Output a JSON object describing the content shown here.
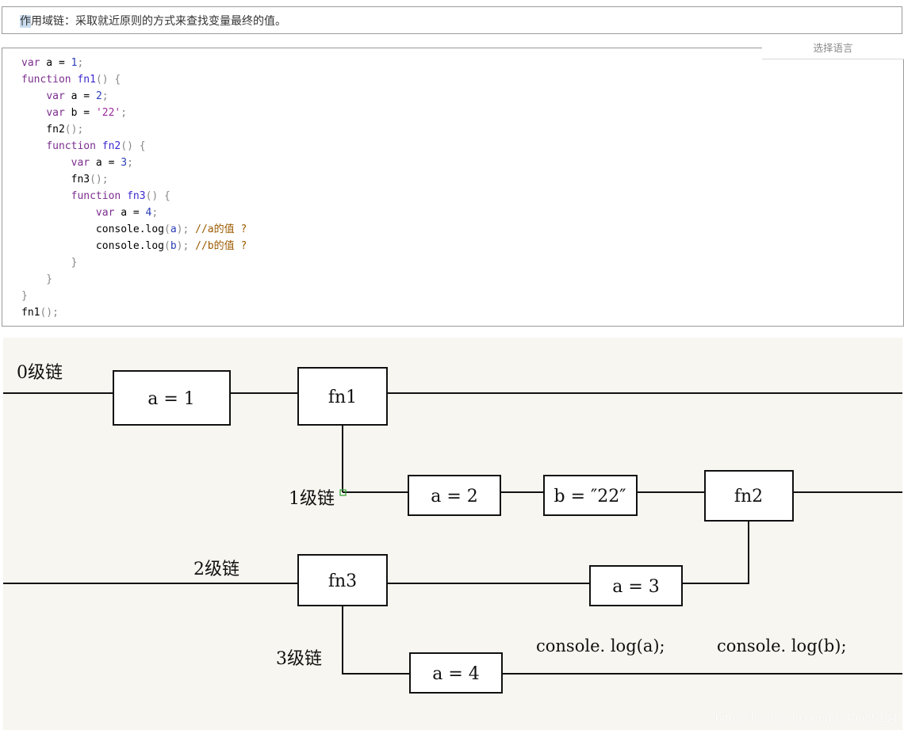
{
  "intro": {
    "highlight": "作",
    "rest": "用域链：采取就近原则的方式来查找变量最终的值。"
  },
  "code_block": {
    "language_selector": "选择语言",
    "lines": [
      [
        {
          "t": "var",
          "c": "k"
        },
        {
          "t": " a = ",
          "c": "x"
        },
        {
          "t": "1",
          "c": "n"
        },
        {
          "t": ";",
          "c": "p"
        }
      ],
      [
        {
          "t": "function",
          "c": "k"
        },
        {
          "t": " ",
          "c": "x"
        },
        {
          "t": "fn1",
          "c": "fn"
        },
        {
          "t": "() {",
          "c": "p"
        }
      ],
      [
        {
          "t": "    ",
          "c": "x"
        },
        {
          "t": "var",
          "c": "k"
        },
        {
          "t": " a = ",
          "c": "x"
        },
        {
          "t": "2",
          "c": "n"
        },
        {
          "t": ";",
          "c": "p"
        }
      ],
      [
        {
          "t": "    ",
          "c": "x"
        },
        {
          "t": "var",
          "c": "k"
        },
        {
          "t": " b = ",
          "c": "x"
        },
        {
          "t": "'22'",
          "c": "s"
        },
        {
          "t": ";",
          "c": "p"
        }
      ],
      [
        {
          "t": "    fn2",
          "c": "x"
        },
        {
          "t": "();",
          "c": "p"
        }
      ],
      [
        {
          "t": "    ",
          "c": "x"
        },
        {
          "t": "function",
          "c": "k"
        },
        {
          "t": " ",
          "c": "x"
        },
        {
          "t": "fn2",
          "c": "fn"
        },
        {
          "t": "() {",
          "c": "p"
        }
      ],
      [
        {
          "t": "        ",
          "c": "x"
        },
        {
          "t": "var",
          "c": "k"
        },
        {
          "t": " a = ",
          "c": "x"
        },
        {
          "t": "3",
          "c": "n"
        },
        {
          "t": ";",
          "c": "p"
        }
      ],
      [
        {
          "t": "        fn3",
          "c": "x"
        },
        {
          "t": "();",
          "c": "p"
        }
      ],
      [
        {
          "t": "        ",
          "c": "x"
        },
        {
          "t": "function",
          "c": "k"
        },
        {
          "t": " ",
          "c": "x"
        },
        {
          "t": "fn3",
          "c": "fn"
        },
        {
          "t": "() {",
          "c": "p"
        }
      ],
      [
        {
          "t": "            ",
          "c": "x"
        },
        {
          "t": "var",
          "c": "k"
        },
        {
          "t": " a = ",
          "c": "x"
        },
        {
          "t": "4",
          "c": "n"
        },
        {
          "t": ";",
          "c": "p"
        }
      ],
      [
        {
          "t": "            console.log",
          "c": "x"
        },
        {
          "t": "(",
          "c": "p"
        },
        {
          "t": "a",
          "c": "n"
        },
        {
          "t": "); ",
          "c": "p"
        },
        {
          "t": "//a的值 ?",
          "c": "c"
        }
      ],
      [
        {
          "t": "            console.log",
          "c": "x"
        },
        {
          "t": "(",
          "c": "p"
        },
        {
          "t": "b",
          "c": "n"
        },
        {
          "t": "); ",
          "c": "p"
        },
        {
          "t": "//b的值 ?",
          "c": "c"
        }
      ],
      [
        {
          "t": "        }",
          "c": "p"
        }
      ],
      [
        {
          "t": "    }",
          "c": "p"
        }
      ],
      [
        {
          "t": "}",
          "c": "p"
        }
      ],
      [
        {
          "t": "fn1",
          "c": "x"
        },
        {
          "t": "();",
          "c": "p"
        }
      ]
    ]
  },
  "diagram": {
    "background": "#f8f6f0",
    "chain_labels": {
      "level0": "0级链",
      "level1": "1级链",
      "level2": "2级链",
      "level3": "3级链"
    },
    "boxes": {
      "a1": "a = 1",
      "fn1": "fn1",
      "a2": "a = 2",
      "b22": "b = ″22″",
      "fn2": "fn2",
      "fn3": "fn3",
      "a3": "a = 3",
      "a4": "a = 4"
    },
    "console_a": "console. log(a);",
    "console_b": "console. log(b);",
    "watermark": "https://blog.csdn.net/qq_40635134"
  }
}
